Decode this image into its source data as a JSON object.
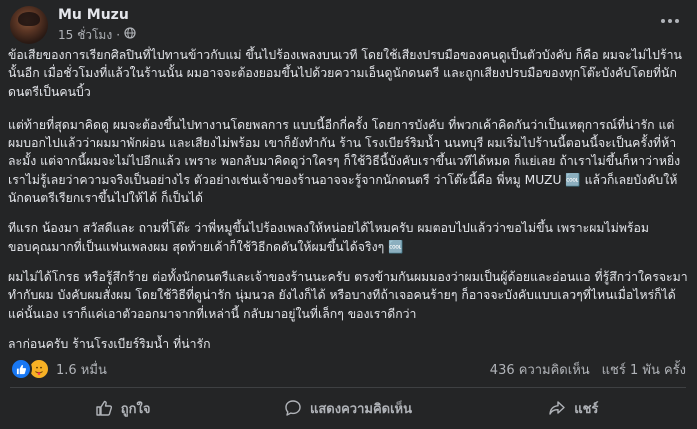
{
  "post": {
    "author": "Mu Muzu",
    "time": "15 ชั่วโมง",
    "privacy_icon": "globe-icon",
    "paragraphs": [
      "ข้อเสียของการเรียกศิลปินที่ไปทานข้าวกับแม่ ขึ้นไปร้องเพลงบนเวที โดยใช้เสียงปรบมือของคนดูเป็นตัวบังคับ ก็คือ ผมจะไม่ไปร้านนั้นอีก เมื่อชั่วโมงที่แล้วในร้านนั้น ผมอาจจะต้องยอมขึ้นไปด้วยความเอ็นดูนักดนตรี และถูกเสียงปรบมือของทุกโต๊ะบังคับโดยที่นักดนตรีเป็นคนบิ้ว",
      "แต่ท้ายที่สุดมาคิดดู ผมจะต้องขึ้นไปทางานโดยพลการ แบบนี้อีกกี่ครั้ง โดยการบังคับ ที่พวกเค้าคิดกันว่าเป็นเหตุการณ์ที่น่ารัก แต่ผมบอกไปแล้วว่าผมมาพักผ่อน และเสียงไม่พร้อม เขาก็ยังทำกัน ร้าน โรงเบียร์ริมน้ำ นนทบุรี ผมเริ่มไปร้านนี้ตอนนี้จะเป็นครั้งที่ห้าละมั้ง แต่จากนี้ผมจะไม่ไปอีกแล้ว เพราะ พอกลับมาคิดดูว่าใครๆ ก็ใช้วิธีนี้บังคับเราขึ้นเวทีได้หมด ก็แย่เลย ถ้าเราไม่ขึ้นก็หาว่าหยิ่ง เราไม่รู้เลยว่าความจริงเป็นอย่างไร ตัวอย่างเช่นเจ้าของร้านอาจจะรู้จากนักดนตรี ว่าโต๊ะนี้คือ พี่หมู MUZU 🆒 แล้วก็เลยบังคับให้นักดนตรีเรียกเราขึ้นไปให้ได้ ก็เป็นได้",
      "ทีแรก น้องมา สวัสดีและ ถามที่โต๊ะ ว่าพี่หมูขึ้นไปร้องเพลงให้หน่อยได้ไหมครับ ผมตอบไปแล้วว่าขอไม่ขึ้น เพราะผมไม่พร้อมขอบคุณมากที่เป็นแฟนเพลงผม สุดท้ายเค้าก็ใช้วิธีกดดันให้ผมขึ้นได้จริงๆ 🆒",
      "ผมไม่ได้โกรธ หรือรู้สึกร้าย ต่อทั้งนักดนตรีและเจ้าของร้านนะครับ ตรงข้ามกันผมมองว่าผมเป็นผู้ด้อยและอ่อนแอ ที่รู้สึกว่าใครจะมาทำกับผม บังคับผมสั่งผม โดยใช้วิธีที่ดูน่ารัก นุ่มนวล ยังไงก็ได้ หรือบางทีถ้าเจอคนร้ายๆ ก็อาจจะบังคับแบบเลวๆที่ไหนเมื่อไหร่ก็ได้ แค่นั้นเอง เราก็แค่เอาตัวออกมาจากที่เหล่านี้ กลับมาอยู่ในที่เล็กๆ ของเราดีกว่า",
      "ลาก่อนครับ ร้านโรงเบียร์ริมน้ำ ที่น่ารัก"
    ]
  },
  "stats": {
    "reactions_count": "1.6 หมื่น",
    "comments": "436 ความคิดเห็น",
    "shares": "แชร์ 1 พัน ครั้ง"
  },
  "actions": {
    "like": "ถูกใจ",
    "comment": "แสดงความคิดเห็น",
    "share": "แชร์"
  },
  "colors": {
    "card_bg": "#242526",
    "text": "#e4e6eb",
    "secondary_text": "#b0b3b8",
    "like_blue": "#1877f2",
    "care_yellow": "#f7b125"
  }
}
